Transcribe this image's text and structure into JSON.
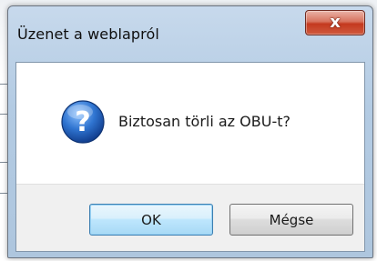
{
  "dialog": {
    "title": "Üzenet a weblapról",
    "close_glyph": "x",
    "message": "Biztosan törli az OBU-t?",
    "icon": "question-icon",
    "buttons": {
      "ok": "OK",
      "cancel": "Mégse"
    }
  },
  "colors": {
    "frame": "#b3cbe3",
    "close_button": "#c4391f",
    "question_icon": "#1f5fb8"
  }
}
